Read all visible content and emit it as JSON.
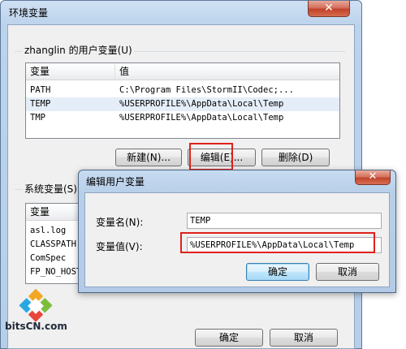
{
  "outer": {
    "title": "环境变量",
    "close_glyph": "✕"
  },
  "user_vars": {
    "group_label": "zhanglin 的用户变量(U)",
    "col_var": "变量",
    "col_val": "值",
    "rows": [
      {
        "name": "PATH",
        "value": "C:\\Program Files\\StormII\\Codec;..."
      },
      {
        "name": "TEMP",
        "value": "%USERPROFILE%\\AppData\\Local\\Temp"
      },
      {
        "name": "TMP",
        "value": "%USERPROFILE%\\AppData\\Local\\Temp"
      }
    ],
    "new_btn": "新建(N)...",
    "edit_btn": "编辑(E)...",
    "delete_btn": "删除(D)"
  },
  "system_vars": {
    "group_label": "系统变量(S)",
    "col_var": "变量",
    "rows": [
      {
        "name": "asl.log"
      },
      {
        "name": "CLASSPATH"
      },
      {
        "name": "ComSpec"
      },
      {
        "name": "FP_NO_HOST"
      }
    ]
  },
  "bottom": {
    "ok_btn": "确定",
    "cancel_btn": "取消"
  },
  "dialog": {
    "title": "编辑用户变量",
    "close_glyph": "✕",
    "name_label": "变量名(N):",
    "name_value": "TEMP",
    "value_label": "变量值(V):",
    "value_value": "%USERPROFILE%\\AppData\\Local\\Temp",
    "ok_btn": "确定",
    "cancel_btn": "取消"
  },
  "watermark": {
    "text": "bitsCN.com"
  },
  "colors": {
    "highlight": "#e0201a",
    "title_bar": "#bcd3ec"
  }
}
